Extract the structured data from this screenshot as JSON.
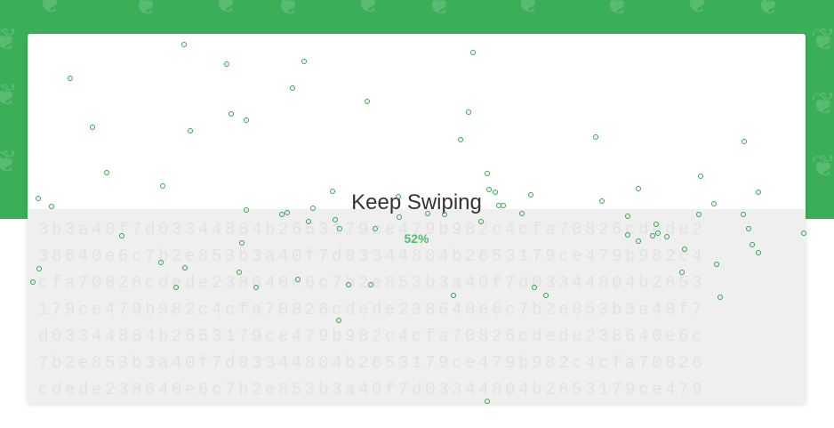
{
  "swipe": {
    "title": "Keep Swiping",
    "progress_label": "52%",
    "progress": 0.52
  },
  "entropy": {
    "lines": [
      "3b3a40f7d03344804b2653179ce479b982c4cfa70826cdede2",
      "38640e6c7b2e853b3a40f7d03344804b2653179ce479b982c4",
      "cfa70826cdede238640e6c7b2e853b3a40f7d03344804b2653",
      "179ce479b982c4cfa70826cdede238640e6c7b2e853b3a40f7",
      "d03344804b2653179ce479b982c4cfa70826cdede238640e6c",
      "7b2e853b3a40f7d03344804b2653179ce479b982c4cfa70826",
      "cdede238640e6c7b2e853b3a40f7d03344804b2653179ce479"
    ]
  },
  "background": {
    "pattern_icon": "seed-icon"
  },
  "colors": {
    "header_green": "#3aaf58",
    "accent_green": "#4fbf6c",
    "dot_green": "#2eaa4f",
    "panel_gray": "#efefef"
  }
}
